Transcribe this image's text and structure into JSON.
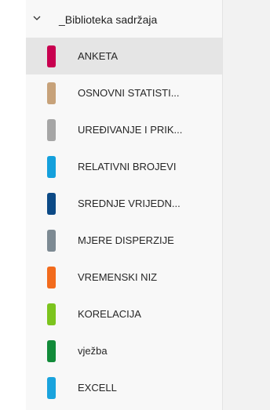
{
  "section": {
    "title": "_Biblioteka sadržaja",
    "icon": "chevron-down-icon"
  },
  "sections": [
    {
      "label": "ANKETA",
      "color": "#c8004f",
      "selected": true
    },
    {
      "label": "OSNOVNI STATISTI...",
      "color": "#c7a27a",
      "selected": false
    },
    {
      "label": "UREĐIVANJE I PRIK...",
      "color": "#a6a6a6",
      "selected": false
    },
    {
      "label": "RELATIVNI BROJEVI",
      "color": "#14a0dc",
      "selected": false
    },
    {
      "label": "SREDNJE VRIJEDN...",
      "color": "#0c4a86",
      "selected": false
    },
    {
      "label": "MJERE DISPERZIJE",
      "color": "#7d8a93",
      "selected": false
    },
    {
      "label": "VREMENSKI NIZ",
      "color": "#f26b1d",
      "selected": false
    },
    {
      "label": "KORELACIJA",
      "color": "#7cc41e",
      "selected": false
    },
    {
      "label": "vježba",
      "color": "#128b3a",
      "selected": false
    },
    {
      "label": "EXCELL",
      "color": "#1aa3dd",
      "selected": false
    }
  ]
}
